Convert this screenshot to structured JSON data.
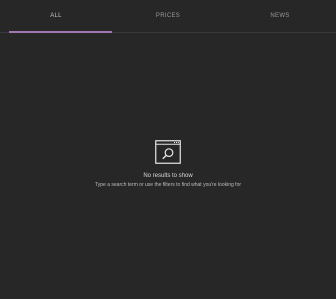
{
  "tabs": [
    {
      "label": "ALL",
      "active": true
    },
    {
      "label": "PRICES",
      "active": false
    },
    {
      "label": "NEWS",
      "active": false
    }
  ],
  "empty_state": {
    "icon": "search-window-icon",
    "title": "No results to show",
    "hint": "Type a search term or use the filters to find what you're looking for"
  },
  "colors": {
    "background": "#272727",
    "accent": "#a276b3",
    "tab_text": "#9a9a9a",
    "message_text": "#d9d9d9"
  }
}
